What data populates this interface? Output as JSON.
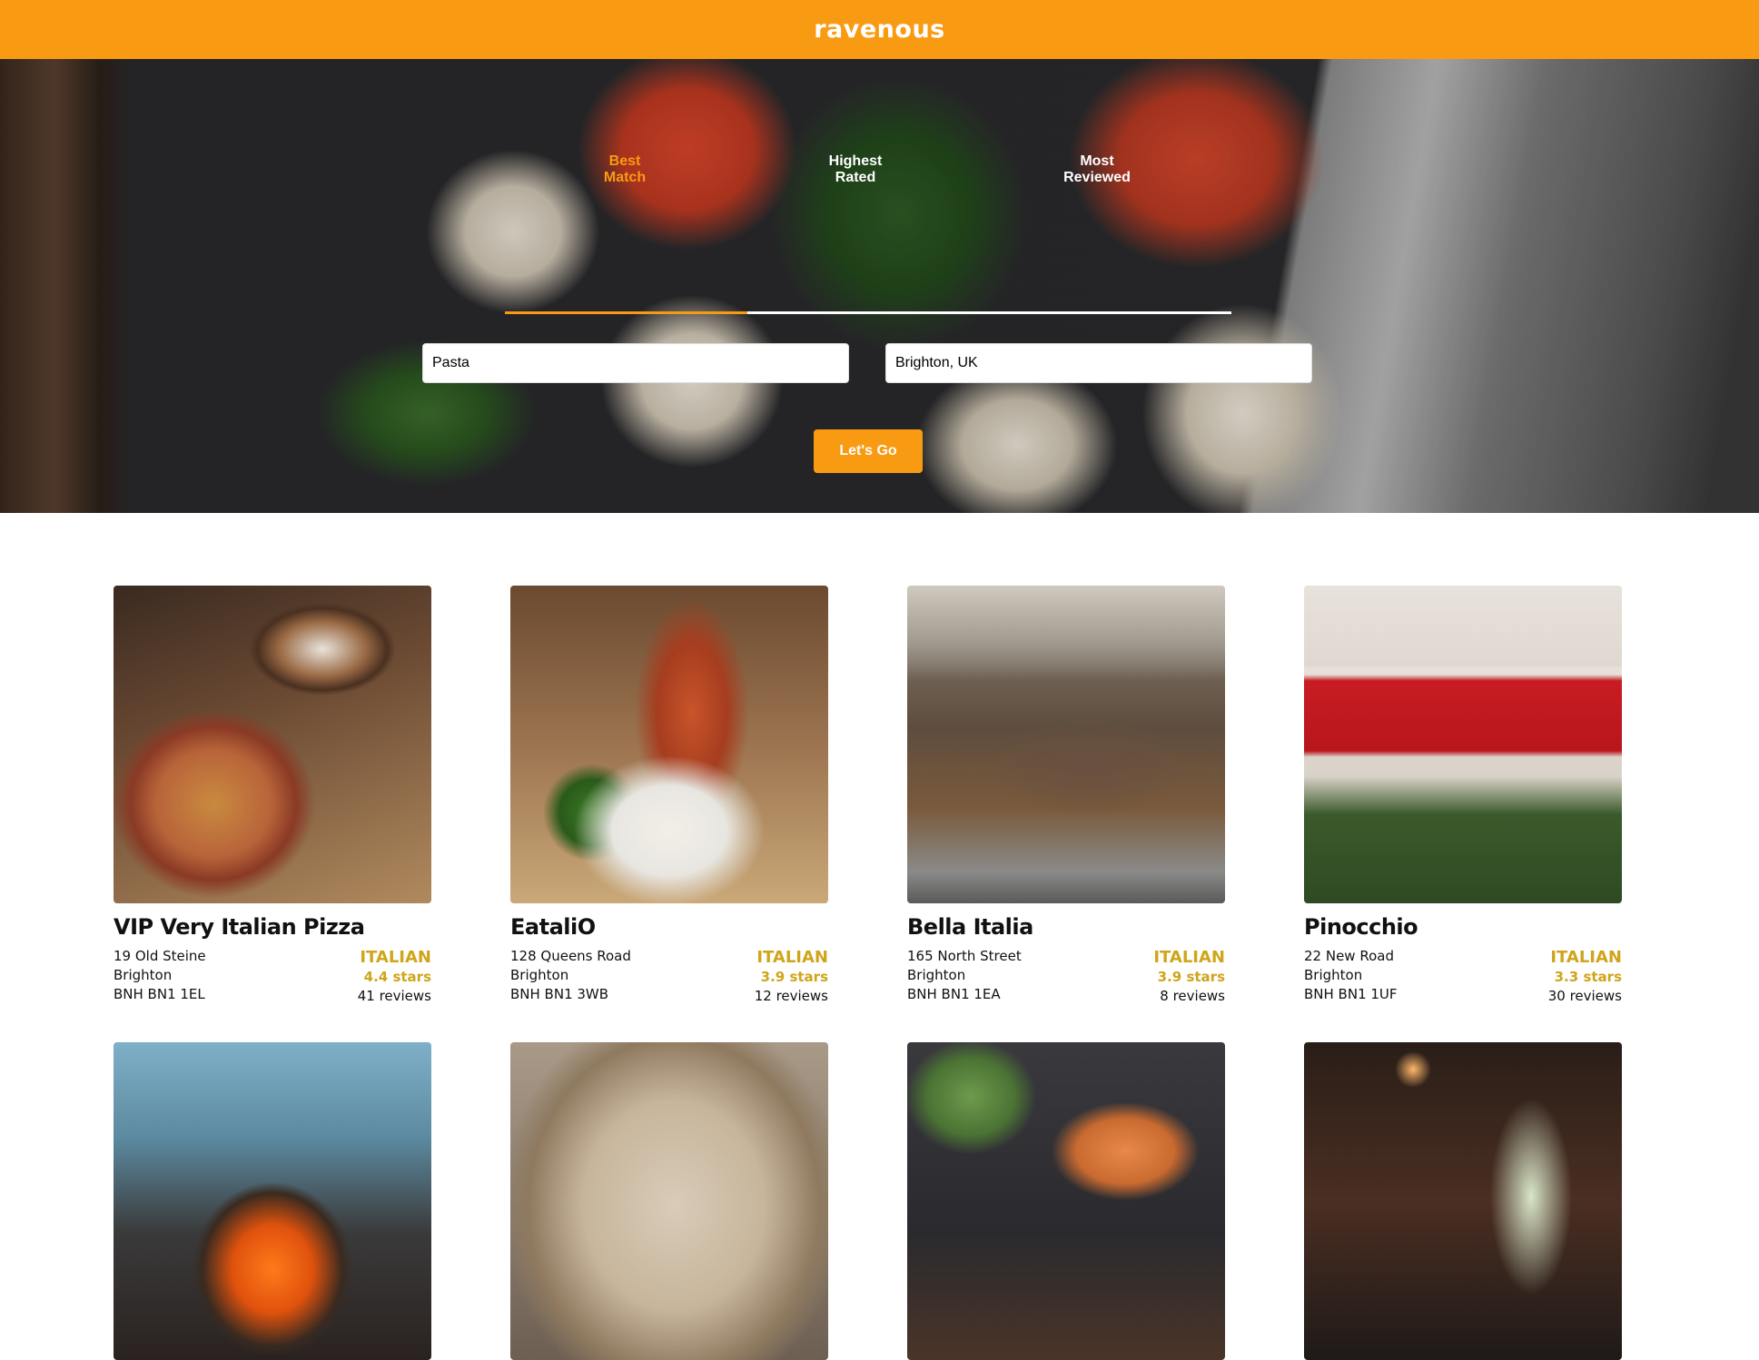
{
  "header": {
    "brand": "ravenous"
  },
  "hero": {
    "sort_tabs": [
      {
        "label_line1": "Best",
        "label_line2": "Match",
        "active": true
      },
      {
        "label_line1": "Highest",
        "label_line2": "Rated",
        "active": false
      },
      {
        "label_line1": "Most",
        "label_line2": "Reviewed",
        "active": false
      }
    ],
    "search": {
      "term_value": "Pasta",
      "location_value": "Brighton, UK"
    },
    "go_label": "Let's Go"
  },
  "colors": {
    "accent": "#f99b12",
    "category": "#cfa51a"
  },
  "businesses": [
    {
      "name": "VIP Very Italian Pizza",
      "address": "19 Old Steine",
      "city": "Brighton",
      "region": "BNH BN1 1EL",
      "category": "ITALIAN",
      "rating": "4.4 stars",
      "reviews": "41 reviews"
    },
    {
      "name": "EataliO",
      "address": "128 Queens Road",
      "city": "Brighton",
      "region": "BNH BN1 3WB",
      "category": "ITALIAN",
      "rating": "3.9 stars",
      "reviews": "12 reviews"
    },
    {
      "name": "Bella Italia",
      "address": "165 North Street",
      "city": "Brighton",
      "region": "BNH BN1 1EA",
      "category": "ITALIAN",
      "rating": "3.9 stars",
      "reviews": "8 reviews"
    },
    {
      "name": "Pinocchio",
      "address": "22 New Road",
      "city": "Brighton",
      "region": "BNH BN1 1UF",
      "category": "ITALIAN",
      "rating": "3.3 stars",
      "reviews": "30 reviews"
    }
  ]
}
